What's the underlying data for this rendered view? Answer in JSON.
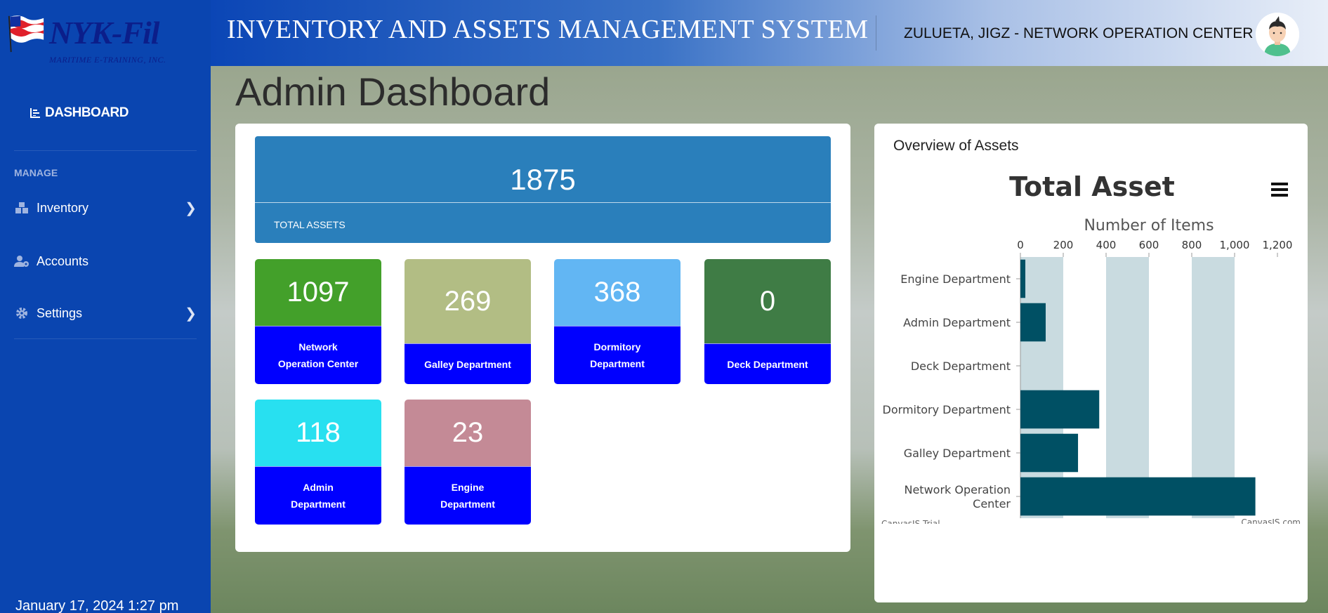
{
  "logo": {
    "name": "NYK-Fil",
    "subtitle": "MARITIME E-TRAINING, INC."
  },
  "header": {
    "system_title": "INVENTORY AND ASSETS MANAGEMENT SYSTEM",
    "user": "ZULUETA, JIGZ - NETWORK OPERATION CENTER"
  },
  "sidebar": {
    "dashboard_label": "DASHBOARD",
    "section_label": "MANAGE",
    "items": [
      {
        "label": "Inventory",
        "icon": "boxes-icon",
        "has_submenu": true
      },
      {
        "label": "Accounts",
        "icon": "user-cog-icon",
        "has_submenu": false
      },
      {
        "label": "Settings",
        "icon": "gear-icon",
        "has_submenu": true
      }
    ],
    "datetime": "January 17, 2024 1:27 pm"
  },
  "page_title": "Admin Dashboard",
  "totals": {
    "value": "1875",
    "label": "TOTAL ASSETS"
  },
  "departments": [
    {
      "value": "1097",
      "label_1": "Network",
      "label_2": "Operation Center",
      "color": "#43a02a"
    },
    {
      "value": "269",
      "label_1": "Galley Department",
      "label_2": "",
      "color": "#b2bd84"
    },
    {
      "value": "368",
      "label_1": "Dormitory",
      "label_2": "Department",
      "color": "#62b6f3"
    },
    {
      "value": "0",
      "label_1": "Deck Department",
      "label_2": "",
      "color": "#3f7c45"
    },
    {
      "value": "118",
      "label_1": "Admin",
      "label_2": "Department",
      "color": "#28e0f0"
    },
    {
      "value": "23",
      "label_1": "Engine",
      "label_2": "Department",
      "color": "#c48a96"
    }
  ],
  "overview": {
    "title": "Overview of Assets",
    "credit_left": "CanvasJS Trial",
    "credit_right": "CanvasJS.com"
  },
  "chart_data": {
    "type": "bar",
    "orientation": "horizontal",
    "title": "Total Asset",
    "value_axis_label": "Number of Items",
    "categories": [
      "Engine Department",
      "Admin Department",
      "Deck Department",
      "Dormitory Department",
      "Galley Department",
      "Network Operation Center"
    ],
    "values": [
      23,
      118,
      0,
      368,
      269,
      1097
    ],
    "xlim": [
      0,
      1200
    ],
    "ticks": [
      "0",
      "200",
      "400",
      "600",
      "800",
      "1,000",
      "1,200"
    ],
    "tick_values": [
      0,
      200,
      400,
      600,
      800,
      1000,
      1200
    ],
    "bar_color": "#005064",
    "band_color": "#c9dbe0",
    "grid": true
  }
}
